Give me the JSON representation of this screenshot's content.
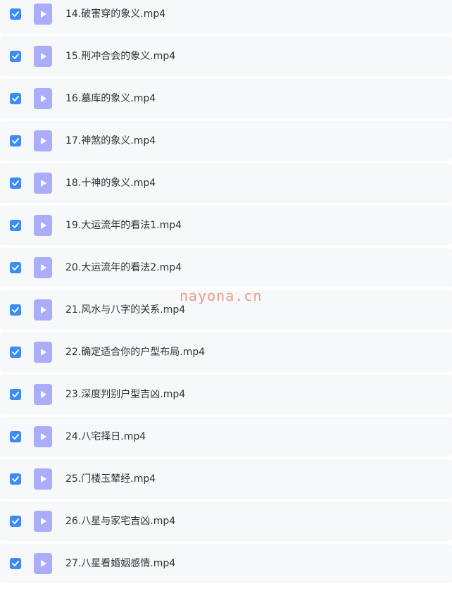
{
  "files": [
    {
      "name": "14.破害穿的象义.mp4",
      "checked": true,
      "icon": "video-file-icon"
    },
    {
      "name": "15.刑冲合会的象义.mp4",
      "checked": true,
      "icon": "video-file-icon"
    },
    {
      "name": "16.墓库的象义.mp4",
      "checked": true,
      "icon": "video-file-icon"
    },
    {
      "name": "17.神煞的象义.mp4",
      "checked": true,
      "icon": "video-file-icon"
    },
    {
      "name": "18.十神的象义.mp4",
      "checked": true,
      "icon": "video-file-icon"
    },
    {
      "name": "19.大运流年的看法1.mp4",
      "checked": true,
      "icon": "video-file-icon"
    },
    {
      "name": "20.大运流年的看法2.mp4",
      "checked": true,
      "icon": "video-file-icon"
    },
    {
      "name": "21.风水与八字的关系.mp4",
      "checked": true,
      "icon": "video-file-icon"
    },
    {
      "name": "22.确定适合你的户型布局.mp4",
      "checked": true,
      "icon": "video-file-icon"
    },
    {
      "name": "23.深度判别户型吉凶.mp4",
      "checked": true,
      "icon": "video-file-icon"
    },
    {
      "name": "24.八宅择日.mp4",
      "checked": true,
      "icon": "video-file-icon"
    },
    {
      "name": "25.门楼玉辇经.mp4",
      "checked": true,
      "icon": "video-file-icon"
    },
    {
      "name": "26.八星与家宅吉凶.mp4",
      "checked": true,
      "icon": "video-file-icon"
    },
    {
      "name": "27.八星看婚姻感情.mp4",
      "checked": true,
      "icon": "video-file-icon"
    }
  ],
  "watermark": "nayona.cn",
  "colors": {
    "checkbox": "#3d8bf7",
    "file_icon": "#a9adfa",
    "row_background": "#f7f8fa",
    "text": "#333333",
    "watermark": "#e8927f"
  }
}
